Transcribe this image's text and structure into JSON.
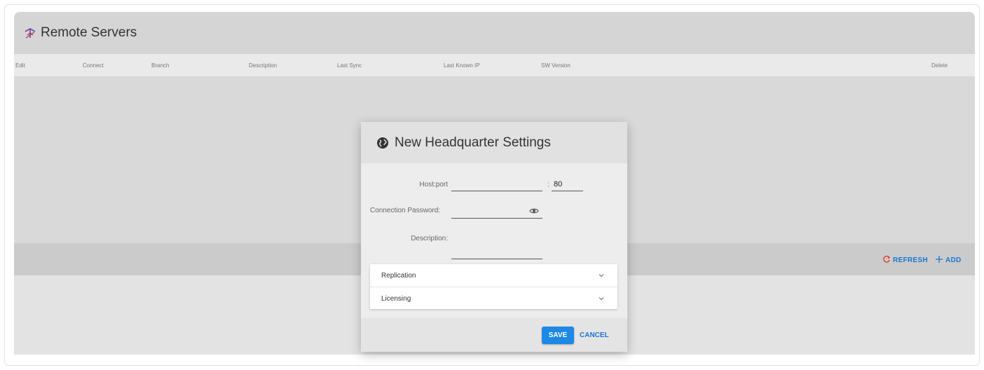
{
  "header": {
    "title": "Remote Servers",
    "logo_icon": "antenna-icon"
  },
  "columns": [
    "Edit",
    "Connect",
    "Branch",
    "Description",
    "Last Sync",
    "Last Known IP",
    "SW Version",
    "Delete"
  ],
  "toolbar": {
    "refresh_label": "REFRESH",
    "add_label": "ADD",
    "refresh_icon": "refresh-icon",
    "add_icon": "plus-icon"
  },
  "dialog": {
    "title": "New Headquarter Settings",
    "title_icon": "globe-icon",
    "host_label": "Host:port",
    "host_value": "",
    "port_value": "80",
    "password_label": "Connection Password:",
    "password_value": "",
    "description_label": "Description:",
    "description_value": "",
    "sections": [
      {
        "label": "Replication"
      },
      {
        "label": "Licensing"
      }
    ],
    "save_label": "SAVE",
    "cancel_label": "CANCEL"
  },
  "colors": {
    "accent": "#1e88e5",
    "refresh": "#e53935",
    "logo": "#7b3fa0"
  }
}
